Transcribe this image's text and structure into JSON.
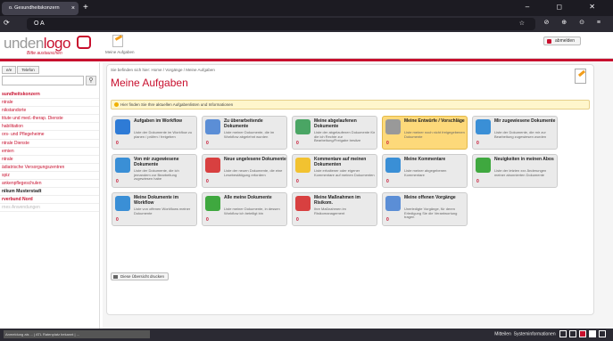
{
  "browser": {
    "tab_title": "o. Gesundheitskonzern",
    "tab_close": "×",
    "new_tab": "+",
    "window_controls": "‒ ◻ ✕",
    "url": "O A",
    "nav_left": "⟳",
    "url_icons": "☆",
    "nav_right": "⊘ ⊕ ⊙ ≡"
  },
  "header": {
    "logo_part1": "unden",
    "logo_part2": "logo",
    "logo_sub": "Bitte austauschen",
    "tasks_label": "Meine Aufgaben",
    "logout_label": "abmelden"
  },
  "sidebar": {
    "tabs": [
      "e/e",
      "Telefon"
    ],
    "items": [
      {
        "label": "sundheitskonzern",
        "style": "bold"
      },
      {
        "label": "ntrale",
        "style": ""
      },
      {
        "label": "nikstandorte",
        "style": ""
      },
      {
        "label": "titute und med.-therap. Dienste",
        "style": ""
      },
      {
        "label": "habilitation",
        "style": ""
      },
      {
        "label": "ors- und Pflegeheime",
        "style": ""
      },
      {
        "label": "ntrale Dienste",
        "style": ""
      },
      {
        "label": "emien",
        "style": ""
      },
      {
        "label": "ntrale",
        "style": ""
      },
      {
        "label": "ädiatrische Versorgungszentren",
        "style": ""
      },
      {
        "label": "spiz",
        "style": ""
      },
      {
        "label": "ankenpflegeschulen",
        "style": ""
      },
      {
        "label": "nikum Musterstadt",
        "style": "dark"
      },
      {
        "label": "rverbund Nord",
        "style": "bold"
      },
      {
        "label": "rnes Anwendungen",
        "style": "grey"
      }
    ]
  },
  "main": {
    "breadcrumb": "Sie befinden sich hier: Home / Vorgänge / Meine Aufgaben",
    "title": "Meine Aufgaben",
    "info_text": "Hier finden Sie Ihre aktuellen Aufgabenlisten und Informationen",
    "print_button": "Diese Übersicht drucken",
    "cards": [
      {
        "title": "Aufgaben im Workflow",
        "desc": "Liste der Dokumente im Workflow zu planen / prüfen / freigeben",
        "count": "0",
        "icon": "workflow-check-icon",
        "color": "#2e7bd6",
        "highlight": false
      },
      {
        "title": "Zu überarbeitende Dokumente",
        "desc": "Liste meiner Dokumente, die im Workflow abgelehnt wurden",
        "count": "0",
        "icon": "document-rework-icon",
        "color": "#5b8ed6",
        "highlight": false
      },
      {
        "title": "Meine abgelaufenen Dokumente",
        "desc": "Liste der abgelaufenen Dokumente für die ich Rechte zur Bearbeitung/Freigabe besitze",
        "count": "0",
        "icon": "expired-document-icon",
        "color": "#4aa564",
        "highlight": false
      },
      {
        "title": "Meine Entwürfe / Vorschläge",
        "desc": "Liste meiner noch nicht freigegebenen Dokumente",
        "count": "0",
        "icon": "drafts-icon",
        "color": "#999999",
        "highlight": true
      },
      {
        "title": "Mir zugewiesene Dokumente",
        "desc": "Liste der Dokumente, die mir zur Bearbeitung zugewiesen wurden",
        "count": "0",
        "icon": "assigned-document-icon",
        "color": "#3a8fd6",
        "highlight": false
      },
      {
        "title": "Von mir zugewiesene Dokumente",
        "desc": "Liste der Dokumente, die ich jemandem zur Bearbeitung zugewiesen habe",
        "count": "0",
        "icon": "forward-arrow-icon",
        "color": "#3a8fd6",
        "highlight": false
      },
      {
        "title": "Neue ungelesene Dokumente",
        "desc": "Liste der neuen Dokumente, die eine Lesebestätigung erfordern",
        "count": "0",
        "icon": "unread-document-icon",
        "color": "#d84040",
        "highlight": false
      },
      {
        "title": "Kommentare auf meinen Dokumenten",
        "desc": "Liste erhaltener oder eigener Kommentare auf meinen Dokumenten",
        "count": "0",
        "icon": "comment-smiley-icon",
        "color": "#f2c230",
        "highlight": false
      },
      {
        "title": "Meine Kommentare",
        "desc": "Liste meiner abgegebenen Kommentare",
        "count": "0",
        "icon": "my-comments-icon",
        "color": "#3a8fd6",
        "highlight": false
      },
      {
        "title": "Neuigkeiten in meinen Abos",
        "desc": "Liste der letzten xxx Änderungen meiner abonnierten Dokumente",
        "count": "0",
        "icon": "green-flag-icon",
        "color": "#3fa83f",
        "highlight": false
      },
      {
        "title": "Meine Dokumente im Workflow",
        "desc": "Liste von offenen Workflows meiner Dokumente",
        "count": "0",
        "icon": "arrow-right-icon",
        "color": "#3a8fd6",
        "highlight": false
      },
      {
        "title": "Alle meine Dokumente",
        "desc": "Liste meiner Dokumente, in dessen Workflow ich beteiligt bin",
        "count": "0",
        "icon": "green-check-icon",
        "color": "#3fa83f",
        "highlight": false
      },
      {
        "title": "Meine Maßnahmen im Risikom.",
        "desc": "Ihre Maßnahmen im Risikomanagement",
        "count": "0",
        "icon": "measures-icon",
        "color": "#d84040",
        "highlight": false
      },
      {
        "title": "Meine offenen Vorgänge",
        "desc": "Unerledigte Vorgänge, für deren Erledigung Sie die Verantwortung tragen",
        "count": "0",
        "icon": "open-tasks-icon",
        "color": "#5b8ed6",
        "highlight": false
      }
    ]
  },
  "statusbar": {
    "left_text": "Anmeldung als ... | ATL Ratenplatz bekannt | ...",
    "messages": "Mitteilen",
    "sysinfo": "Systeminformationen"
  }
}
